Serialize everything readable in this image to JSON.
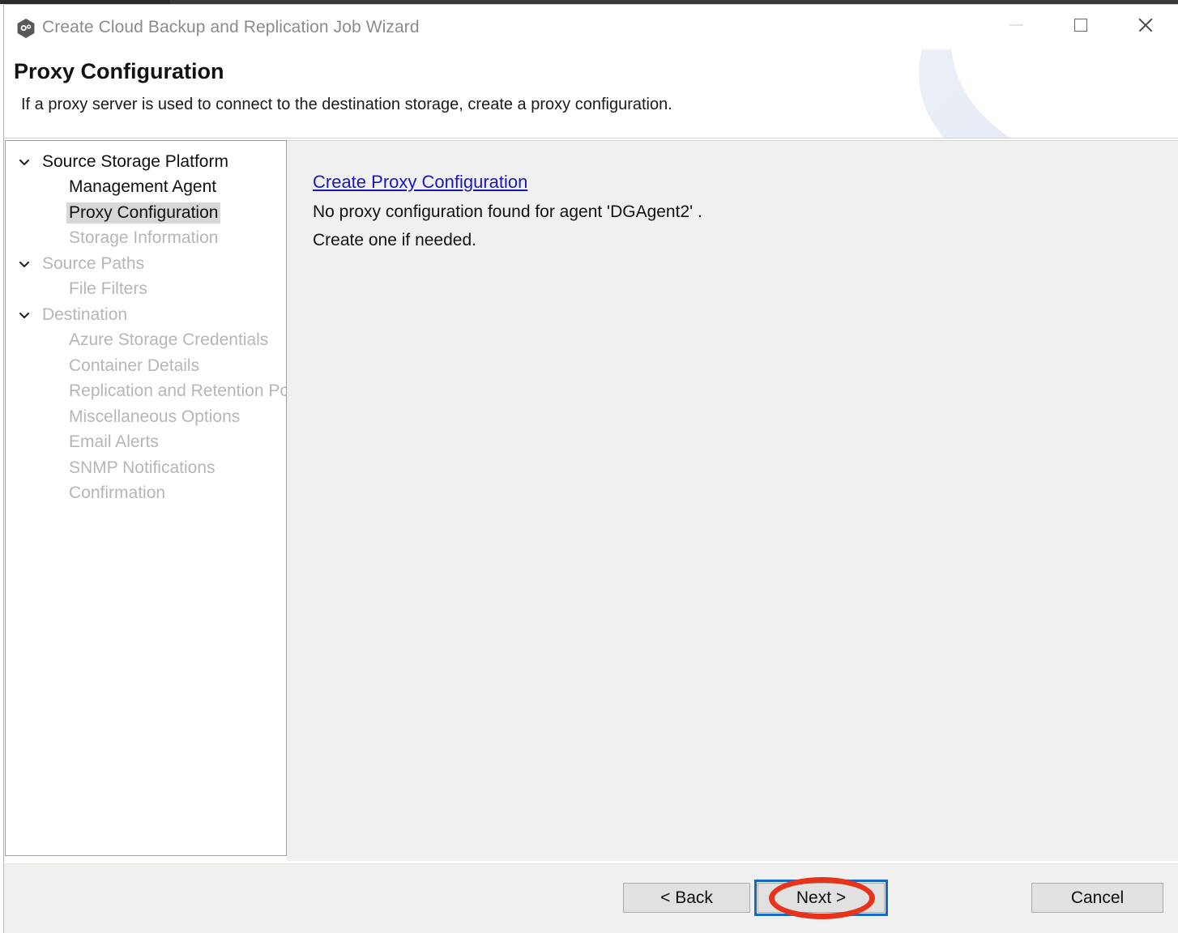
{
  "window": {
    "title": "Create Cloud Backup and Replication Job Wizard",
    "app_icon": "hexagon-app-icon",
    "controls": {
      "minimize": "minimize-icon",
      "maximize": "maximize-icon",
      "close": "close-icon"
    }
  },
  "header": {
    "title": "Proxy Configuration",
    "subtitle": "If a proxy server is used to connect to the destination storage, create a proxy configuration."
  },
  "sidebar": {
    "items": [
      {
        "label": "Source Storage Platform",
        "level": 0,
        "chevron": true,
        "state": "visited"
      },
      {
        "label": "Management Agent",
        "level": 1,
        "chevron": false,
        "state": "visited"
      },
      {
        "label": "Proxy Configuration",
        "level": 1,
        "chevron": false,
        "state": "selected"
      },
      {
        "label": "Storage Information",
        "level": 1,
        "chevron": false,
        "state": "disabled"
      },
      {
        "label": "Source Paths",
        "level": 0,
        "chevron": true,
        "state": "disabled"
      },
      {
        "label": "File Filters",
        "level": 1,
        "chevron": false,
        "state": "disabled"
      },
      {
        "label": "Destination",
        "level": 0,
        "chevron": true,
        "state": "disabled"
      },
      {
        "label": "Azure Storage Credentials",
        "level": 1,
        "chevron": false,
        "state": "disabled"
      },
      {
        "label": "Container Details",
        "level": 1,
        "chevron": false,
        "state": "disabled"
      },
      {
        "label": "Replication and Retention Policy",
        "level": 1,
        "chevron": false,
        "state": "disabled"
      },
      {
        "label": "Miscellaneous Options",
        "level": 1,
        "chevron": false,
        "state": "disabled"
      },
      {
        "label": "Email Alerts",
        "level": 1,
        "chevron": false,
        "state": "disabled"
      },
      {
        "label": "SNMP Notifications",
        "level": 1,
        "chevron": false,
        "state": "disabled"
      },
      {
        "label": "Confirmation",
        "level": 1,
        "chevron": false,
        "state": "disabled"
      }
    ]
  },
  "content": {
    "link_label": "Create Proxy Configuration",
    "message_line1": "No proxy configuration found for agent 'DGAgent2' .",
    "message_line2": "Create one if needed."
  },
  "footer": {
    "back_label": "< Back",
    "next_label": "Next >",
    "cancel_label": "Cancel"
  },
  "annotation": {
    "shape": "ellipse",
    "color": "#e8331c",
    "target": "next-button"
  },
  "colors": {
    "link": "#1a1ab0",
    "selection_bg": "#d7d7d7",
    "panel_bg": "#f0f0f0",
    "focus_border": "#1669c8",
    "disabled_text": "#b6b6b6"
  }
}
